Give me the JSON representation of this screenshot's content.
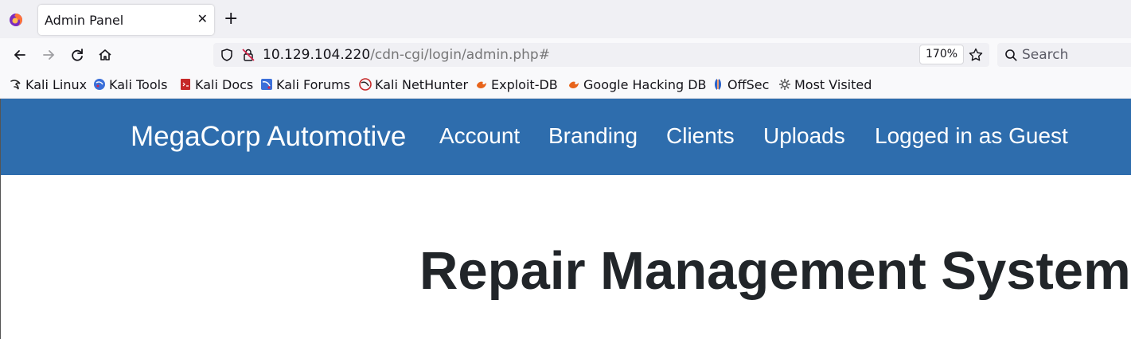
{
  "browser": {
    "tab_title": "Admin Panel",
    "tab_close": "✕",
    "new_tab": "+",
    "url_host": "10.129.104.220",
    "url_path": "/cdn-cgi/login/admin.php#",
    "zoom": "170%",
    "search_placeholder": "Search"
  },
  "bookmarks": [
    {
      "label": "Kali Linux",
      "icon": "kali-dragon-icon",
      "color": "#222222"
    },
    {
      "label": "Kali Tools",
      "icon": "kali-tools-icon",
      "color": "#3b6fd9"
    },
    {
      "label": "Kali Docs",
      "icon": "kali-docs-icon",
      "color": "#c62828"
    },
    {
      "label": "Kali Forums",
      "icon": "kali-forums-icon",
      "color": "#3b6fd9"
    },
    {
      "label": "Kali NetHunter",
      "icon": "nethunter-icon",
      "color": "#c62828"
    },
    {
      "label": "Exploit-DB",
      "icon": "exploit-db-icon",
      "color": "#e8641b"
    },
    {
      "label": "Google Hacking DB",
      "icon": "ghdb-icon",
      "color": "#e8641b"
    },
    {
      "label": "OffSec",
      "icon": "offsec-icon",
      "color": "#2a62c9"
    },
    {
      "label": "Most Visited",
      "icon": "gear-icon",
      "color": "#555555"
    }
  ],
  "site": {
    "brand": "MegaCorp Automotive",
    "nav": [
      "Account",
      "Branding",
      "Clients",
      "Uploads",
      "Logged in as Guest"
    ],
    "heading": "Repair Management System",
    "nav_color": "#2e6dad"
  }
}
